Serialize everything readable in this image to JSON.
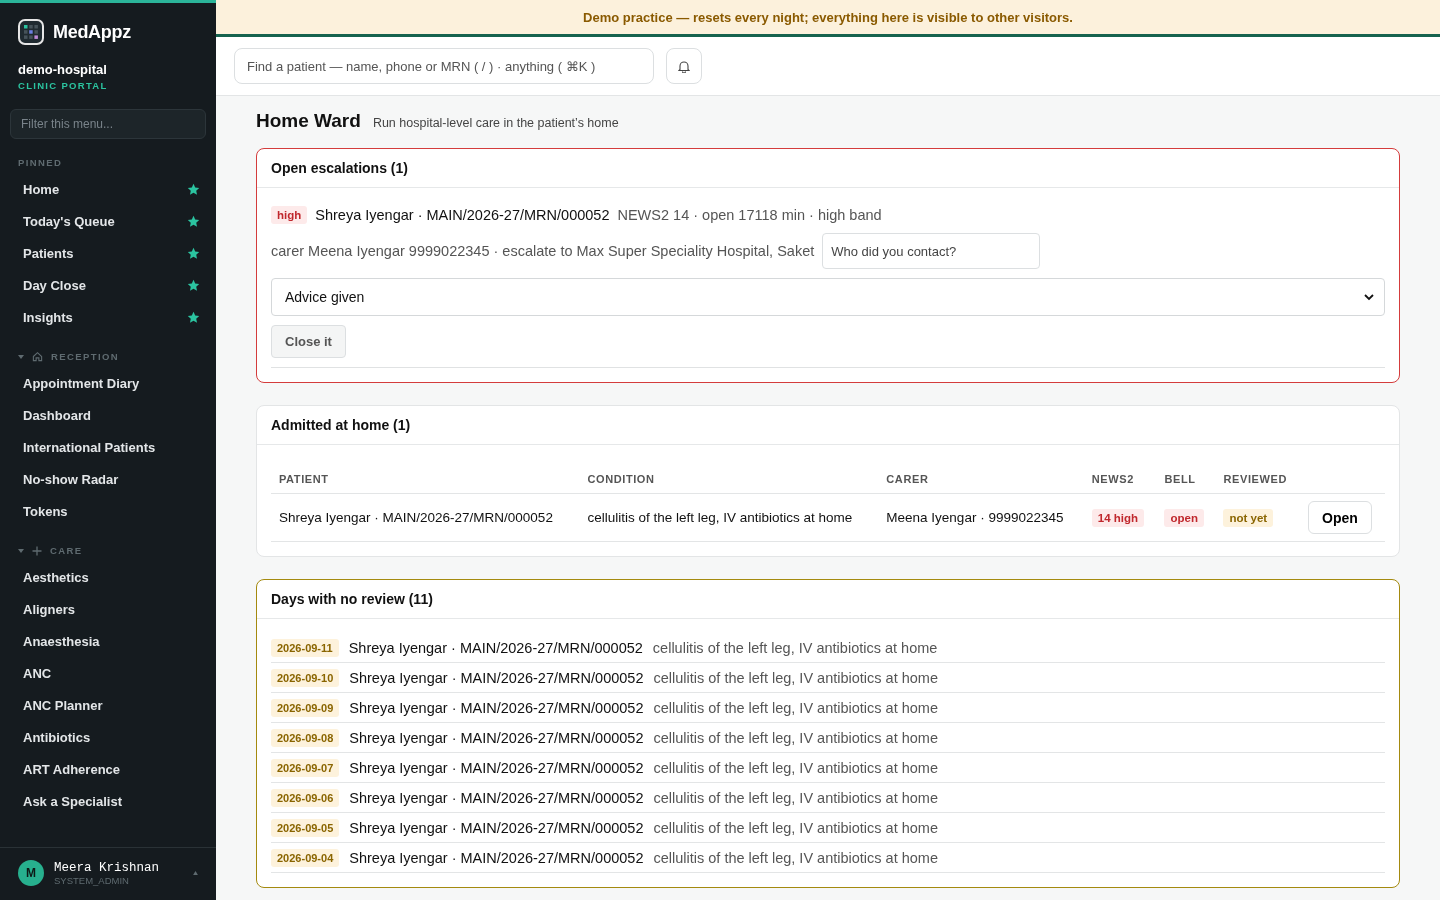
{
  "sidebar": {
    "brand": "MedAppz",
    "org": "demo-hospital",
    "portal": "CLINIC PORTAL",
    "filter_placeholder": "Filter this menu...",
    "groups": [
      {
        "label": "PINNED",
        "kind": "pinned",
        "items": [
          {
            "label": "Home",
            "pinned": true
          },
          {
            "label": "Today's Queue",
            "pinned": true
          },
          {
            "label": "Patients",
            "pinned": true
          },
          {
            "label": "Day Close",
            "pinned": true
          },
          {
            "label": "Insights",
            "pinned": true
          }
        ]
      },
      {
        "label": "RECEPTION",
        "kind": "home",
        "expanded": true,
        "items": [
          {
            "label": "Appointment Diary",
            "pinned": false
          },
          {
            "label": "Dashboard",
            "pinned": false
          },
          {
            "label": "International Patients",
            "pinned": false
          },
          {
            "label": "No-show Radar",
            "pinned": false
          },
          {
            "label": "Tokens",
            "pinned": false
          }
        ]
      },
      {
        "label": "CARE",
        "kind": "plus",
        "expanded": true,
        "items": [
          {
            "label": "Aesthetics",
            "pinned": false
          },
          {
            "label": "Aligners",
            "pinned": false
          },
          {
            "label": "Anaesthesia",
            "pinned": false
          },
          {
            "label": "ANC",
            "pinned": false
          },
          {
            "label": "ANC Planner",
            "pinned": false
          },
          {
            "label": "Antibiotics",
            "pinned": false
          },
          {
            "label": "ART Adherence",
            "pinned": false
          },
          {
            "label": "Ask a Specialist",
            "pinned": false
          }
        ]
      }
    ],
    "user": {
      "initial": "M",
      "name": "Meera Krishnan",
      "role": "SYSTEM_ADMIN"
    }
  },
  "banner": "Demo practice — resets every night; everything here is visible to other visitors.",
  "search": {
    "placeholder": "Find a patient — name, phone or MRN ( / ) · anything ( ⌘K )"
  },
  "page": {
    "title": "Home Ward",
    "subtitle": "Run hospital-level care in the patient’s home"
  },
  "escalations": {
    "title": "Open escalations (1)",
    "items": [
      {
        "severity": "high",
        "patient": "Shreya Iyengar · MAIN/2026-27/MRN/000052",
        "detail": "NEWS2 14 · open 17118 min · high band",
        "contact": "carer Meena Iyengar 9999022345 · escalate to Max Super Speciality Hospital, Saket",
        "contact_placeholder": "Who did you contact?",
        "outcome": "Advice given",
        "action": "Close it"
      }
    ]
  },
  "admitted": {
    "title": "Admitted at home (1)",
    "columns": [
      "PATIENT",
      "CONDITION",
      "CARER",
      "NEWS2",
      "BELL",
      "REVIEWED"
    ],
    "rows": [
      {
        "patient": "Shreya Iyengar · MAIN/2026-27/MRN/000052",
        "condition": "cellulitis of the left leg, IV antibiotics at home",
        "carer": "Meena Iyengar · 9999022345",
        "badges": [
          {
            "text": "14 high",
            "kind": "danger"
          },
          {
            "text": "open",
            "kind": "danger"
          },
          {
            "text": "not yet",
            "kind": "warn"
          }
        ],
        "action": "Open"
      }
    ]
  },
  "no_review": {
    "title": "Days with no review (11)",
    "rows": [
      {
        "date": "2026-09-11",
        "patient": "Shreya Iyengar · MAIN/2026-27/MRN/000052",
        "condition": "cellulitis of the left leg, IV antibiotics at home"
      },
      {
        "date": "2026-09-10",
        "patient": "Shreya Iyengar · MAIN/2026-27/MRN/000052",
        "condition": "cellulitis of the left leg, IV antibiotics at home"
      },
      {
        "date": "2026-09-09",
        "patient": "Shreya Iyengar · MAIN/2026-27/MRN/000052",
        "condition": "cellulitis of the left leg, IV antibiotics at home"
      },
      {
        "date": "2026-09-08",
        "patient": "Shreya Iyengar · MAIN/2026-27/MRN/000052",
        "condition": "cellulitis of the left leg, IV antibiotics at home"
      },
      {
        "date": "2026-09-07",
        "patient": "Shreya Iyengar · MAIN/2026-27/MRN/000052",
        "condition": "cellulitis of the left leg, IV antibiotics at home"
      },
      {
        "date": "2026-09-06",
        "patient": "Shreya Iyengar · MAIN/2026-27/MRN/000052",
        "condition": "cellulitis of the left leg, IV antibiotics at home"
      },
      {
        "date": "2026-09-05",
        "patient": "Shreya Iyengar · MAIN/2026-27/MRN/000052",
        "condition": "cellulitis of the left leg, IV antibiotics at home"
      },
      {
        "date": "2026-09-04",
        "patient": "Shreya Iyengar · MAIN/2026-27/MRN/000052",
        "condition": "cellulitis of the left leg, IV antibiotics at home"
      }
    ]
  }
}
